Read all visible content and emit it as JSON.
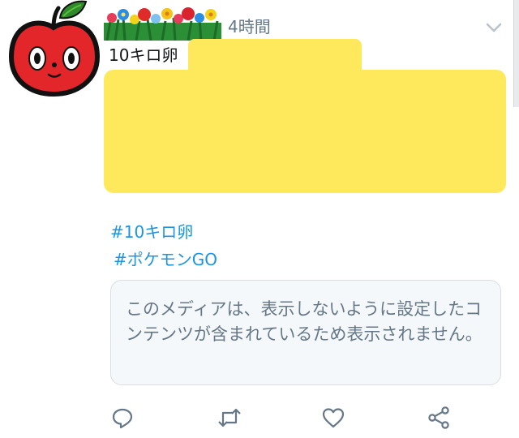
{
  "tweet": {
    "timestamp": "4時間",
    "first_line": "10キロ卵",
    "hashtags": [
      "#10キロ卵",
      "#ポケモンGO"
    ],
    "sensitive_notice": "このメディアは、表示しないように設定したコンテンツが含まれているため表示されません。"
  },
  "icons": {
    "avatar": "apple-character-avatar",
    "more": "chevron-down-icon",
    "reply": "reply-icon",
    "retweet": "retweet-icon",
    "like": "heart-icon",
    "share": "share-icon"
  },
  "colors": {
    "hashtag": "#1c94e0",
    "redaction": "#fde95b",
    "secondary_text": "#657786",
    "icon": "#657786"
  }
}
